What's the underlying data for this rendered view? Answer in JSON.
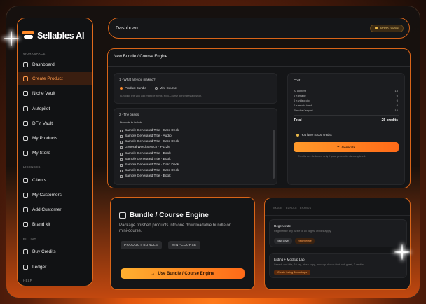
{
  "app": {
    "name": "Sellables AI",
    "accent": "#ff8a2a"
  },
  "sidebar": {
    "sections": {
      "workspace": "WORKSPACE",
      "licenses": "LICENSES",
      "billing": "BILLING",
      "help": "HELP"
    },
    "items": [
      {
        "label": "Dashboard",
        "icon": "dashboard-icon"
      },
      {
        "label": "Create Product",
        "icon": "create-icon",
        "active": true
      },
      {
        "label": "Niche Vault",
        "icon": "vault-icon"
      },
      {
        "label": "Autopilot",
        "icon": "autopilot-icon"
      },
      {
        "label": "DFY Vault",
        "icon": "dfy-icon"
      },
      {
        "label": "My Products",
        "icon": "products-icon"
      },
      {
        "label": "My Store",
        "icon": "store-icon"
      },
      {
        "label": "Clients",
        "icon": "clients-icon"
      },
      {
        "label": "My Customers",
        "icon": "customers-icon"
      },
      {
        "label": "Add Customer",
        "icon": "add-customer-icon"
      },
      {
        "label": "Brand kit",
        "icon": "brand-icon"
      },
      {
        "label": "Buy Credits",
        "icon": "credits-icon"
      },
      {
        "label": "Ledger",
        "icon": "ledger-icon"
      }
    ]
  },
  "topbar": {
    "title": "Dashboard",
    "credits": "86230 credits"
  },
  "main": {
    "title": "New Bundle / Course Engine",
    "step1": {
      "heading": "1 · What are you making?",
      "options": [
        "Product Bundle",
        "Mini-Course"
      ],
      "hint": "Bundling lets you add multiple items. Mini-Course generates a lesson."
    },
    "step2": {
      "heading": "2 · The basics",
      "sub": "Products to include",
      "products": [
        "Sample Generated Title · Card Deck",
        "Sample Generated Title · Audio",
        "Sample Generated Title · Card Deck",
        "General Word Search · Puzzle",
        "Sample Generated Title · Book",
        "Sample Generated Title · Book",
        "Sample Generated Title · Card Deck",
        "Sample Generated Title · Card Deck",
        "Sample Generated Title · Book"
      ]
    },
    "cost": {
      "title": "Cost",
      "rows": [
        {
          "label": "AI content",
          "value": "15"
        },
        {
          "label": "0 × image",
          "value": "0"
        },
        {
          "label": "0 × video clip",
          "value": "0"
        },
        {
          "label": "0 × music track",
          "value": "0"
        },
        {
          "label": "Render / export",
          "value": "10"
        }
      ],
      "total_label": "Total",
      "total_value": "25 credits",
      "balance": "You have 87000 credits",
      "button": "Generate",
      "note": "Credits are deducted only if your generation is completed."
    }
  },
  "card": {
    "title": "Bundle / Course Engine",
    "desc": "Package finished products into one downloadable bundle or mini-course.",
    "tags": [
      "PRODUCT BUNDLE",
      "MINI-COURSE"
    ],
    "button": "Use Bundle / Course Engine"
  },
  "card2": {
    "tabs": [
      "IMAGE",
      "BUNDLE",
      "BRANDS"
    ],
    "item1": {
      "title": "Regenerate",
      "desc": "Regenerate any AI file or all pages; credits apply.",
      "btn1": "New cover",
      "btn2": "Regenerate"
    },
    "item2": {
      "title": "Listing + Mockup Lab",
      "desc": "Search and title, 10-tag, store copy, mockup photos that look great, 3 credits.",
      "btn": "Create listing & mockups"
    }
  }
}
